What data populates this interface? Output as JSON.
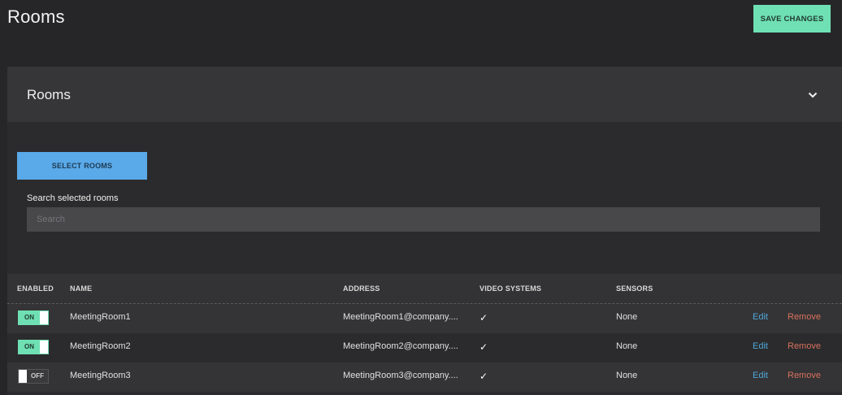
{
  "header": {
    "title": "Rooms",
    "save_label": "SAVE CHANGES"
  },
  "panel": {
    "title": "Rooms",
    "select_label": "SELECT ROOMS",
    "search_label": "Search selected rooms",
    "search_placeholder": "Search",
    "search_value": ""
  },
  "table": {
    "columns": [
      "ENABLED",
      "NAME",
      "ADDRESS",
      "VIDEO SYSTEMS",
      "SENSORS"
    ],
    "rows": [
      {
        "enabled": "ON",
        "name": "MeetingRoom1",
        "address": "MeetingRoom1@company....",
        "video": "✓",
        "sensors": "None",
        "edit": "Edit",
        "remove": "Remove"
      },
      {
        "enabled": "ON",
        "name": "MeetingRoom2",
        "address": "MeetingRoom2@company....",
        "video": "✓",
        "sensors": "None",
        "edit": "Edit",
        "remove": "Remove"
      },
      {
        "enabled": "OFF",
        "name": "MeetingRoom3",
        "address": "MeetingRoom3@company....",
        "video": "✓",
        "sensors": "None",
        "edit": "Edit",
        "remove": "Remove"
      }
    ]
  },
  "colors": {
    "accent_green": "#6fe0b3",
    "accent_blue": "#5aa9e8",
    "link_edit": "#4fa7d8",
    "link_remove": "#d8715d",
    "background": "#262628"
  },
  "icons": {
    "collapse": "chevron-down-icon",
    "video": "check-icon"
  }
}
